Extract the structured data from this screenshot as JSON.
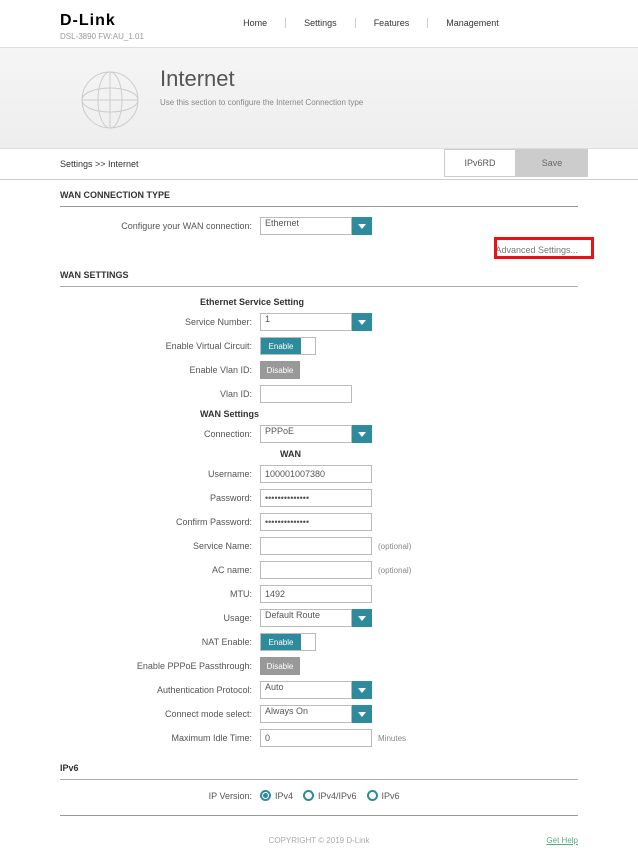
{
  "header": {
    "brand": "D-Link",
    "model": "DSL-3890   FW:AU_1.01",
    "nav": [
      "Home",
      "Settings",
      "Features",
      "Management"
    ]
  },
  "hero": {
    "title": "Internet",
    "subtitle": "Use this section to configure the Internet Connection type"
  },
  "crumbs": "Settings >> Internet",
  "buttons": {
    "tab": "IPv6RD",
    "save": "Save"
  },
  "sections": {
    "wan_conn_type": "WAN CONNECTION TYPE",
    "wan_settings": "WAN SETTINGS",
    "ipv6": "IPv6"
  },
  "fields": {
    "configure_wan_label": "Configure your WAN connection:",
    "configure_wan_value": "Ethernet",
    "advanced": "Advanced Settings...",
    "eth_service_setting": "Ethernet Service Setting",
    "service_number_label": "Service Number:",
    "service_number_value": "1",
    "enable_vc_label": "Enable Virtual Circuit:",
    "enable_vc_value": "Enable",
    "enable_vlan_label": "Enable Vlan ID:",
    "enable_vlan_value": "Disable",
    "vlan_id_label": "Vlan ID:",
    "vlan_id_value": "",
    "wan_settings_sub": "WAN Settings",
    "connection_label": "Connection:",
    "connection_value": "PPPoE",
    "wan_sub": "WAN",
    "username_label": "Username:",
    "username_value": "100001007380",
    "password_label": "Password:",
    "password_value": "••••••••••••••",
    "confirm_pw_label": "Confirm Password:",
    "confirm_pw_value": "••••••••••••••",
    "service_name_label": "Service Name:",
    "service_name_value": "",
    "ac_name_label": "AC name:",
    "ac_name_value": "",
    "optional": "(optional)",
    "mtu_label": "MTU:",
    "mtu_value": "1492",
    "usage_label": "Usage:",
    "usage_value": "Default Route",
    "nat_enable_label": "NAT Enable:",
    "nat_enable_value": "Enable",
    "pppoe_pass_label": "Enable PPPoE Passthrough:",
    "pppoe_pass_value": "Disable",
    "auth_proto_label": "Authentication Protocol:",
    "auth_proto_value": "Auto",
    "connect_mode_label": "Connect mode select:",
    "connect_mode_value": "Always On",
    "max_idle_label": "Maximum Idle Time:",
    "max_idle_value": "0",
    "minutes": "Minutes",
    "ip_version_label": "IP Version:",
    "ipv4": "IPv4",
    "ipv4ipv6": "IPv4/IPv6",
    "ipv6_opt": "IPv6"
  },
  "footer": {
    "copyright": "COPYRIGHT © 2019 D-Link",
    "help": "Get Help"
  }
}
